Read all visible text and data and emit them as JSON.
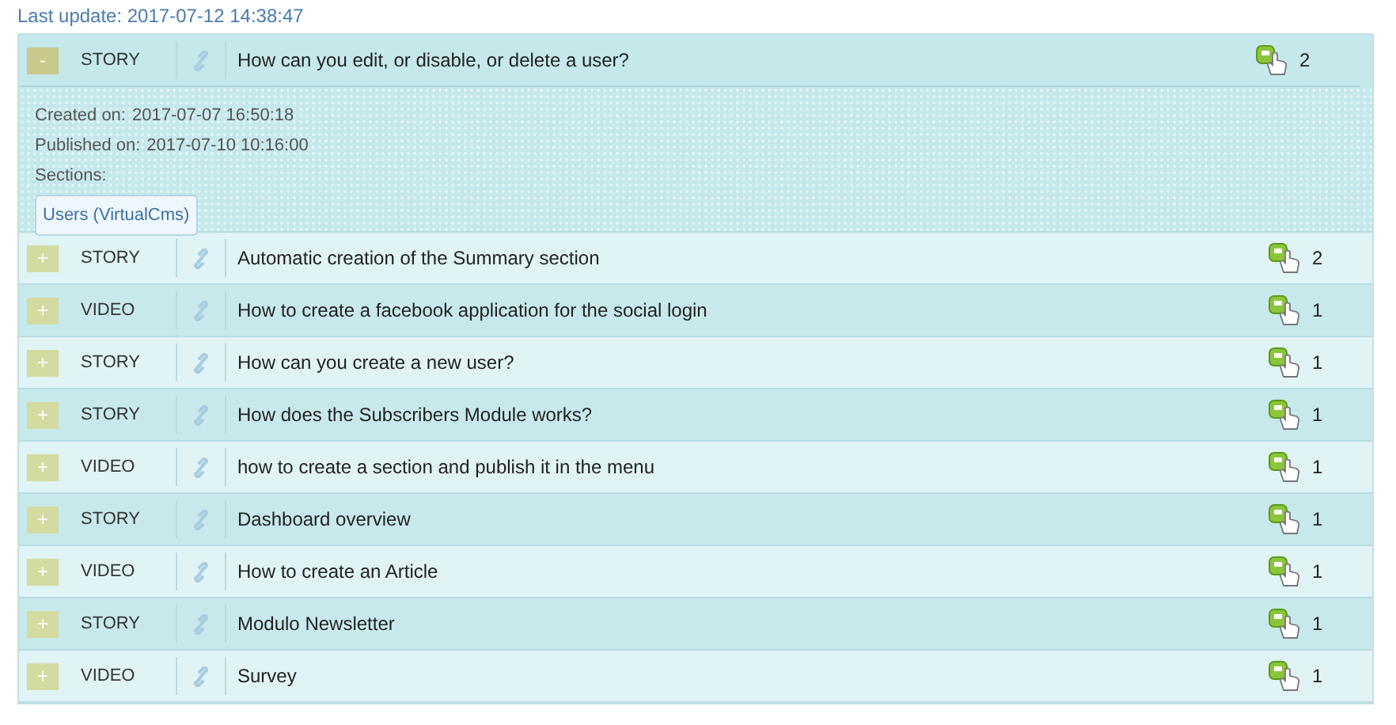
{
  "last_update": "Last update: 2017-07-12 14:38:47",
  "items": [
    {
      "toggle": "-",
      "expanded": true,
      "type": "STORY",
      "title": "How can you edit, or disable, or delete a user?",
      "count": "2",
      "details": {
        "created_label": "Created on:",
        "created": "2017-07-07 16:50:18",
        "published_label": "Published on:",
        "published": "2017-07-10 10:16:00",
        "sections_label": "Sections:",
        "sections": [
          "Users (VirtualCms)"
        ]
      }
    },
    {
      "toggle": "+",
      "expanded": false,
      "type": "STORY",
      "title": "Automatic creation of the Summary section",
      "count": "2"
    },
    {
      "toggle": "+",
      "expanded": false,
      "type": "VIDEO",
      "title": "How to create a facebook application for the social login",
      "count": "1"
    },
    {
      "toggle": "+",
      "expanded": false,
      "type": "STORY",
      "title": "How can you create a new user?",
      "count": "1"
    },
    {
      "toggle": "+",
      "expanded": false,
      "type": "STORY",
      "title": "How does the Subscribers Module works?",
      "count": "1"
    },
    {
      "toggle": "+",
      "expanded": false,
      "type": "VIDEO",
      "title": "how to create a section and publish it in the menu",
      "count": "1"
    },
    {
      "toggle": "+",
      "expanded": false,
      "type": "STORY",
      "title": "Dashboard overview",
      "count": "1"
    },
    {
      "toggle": "+",
      "expanded": false,
      "type": "VIDEO",
      "title": "How to create an Article",
      "count": "1"
    },
    {
      "toggle": "+",
      "expanded": false,
      "type": "STORY",
      "title": "Modulo Newsletter",
      "count": "1"
    },
    {
      "toggle": "+",
      "expanded": false,
      "type": "VIDEO",
      "title": "Survey",
      "count": "1"
    }
  ]
}
